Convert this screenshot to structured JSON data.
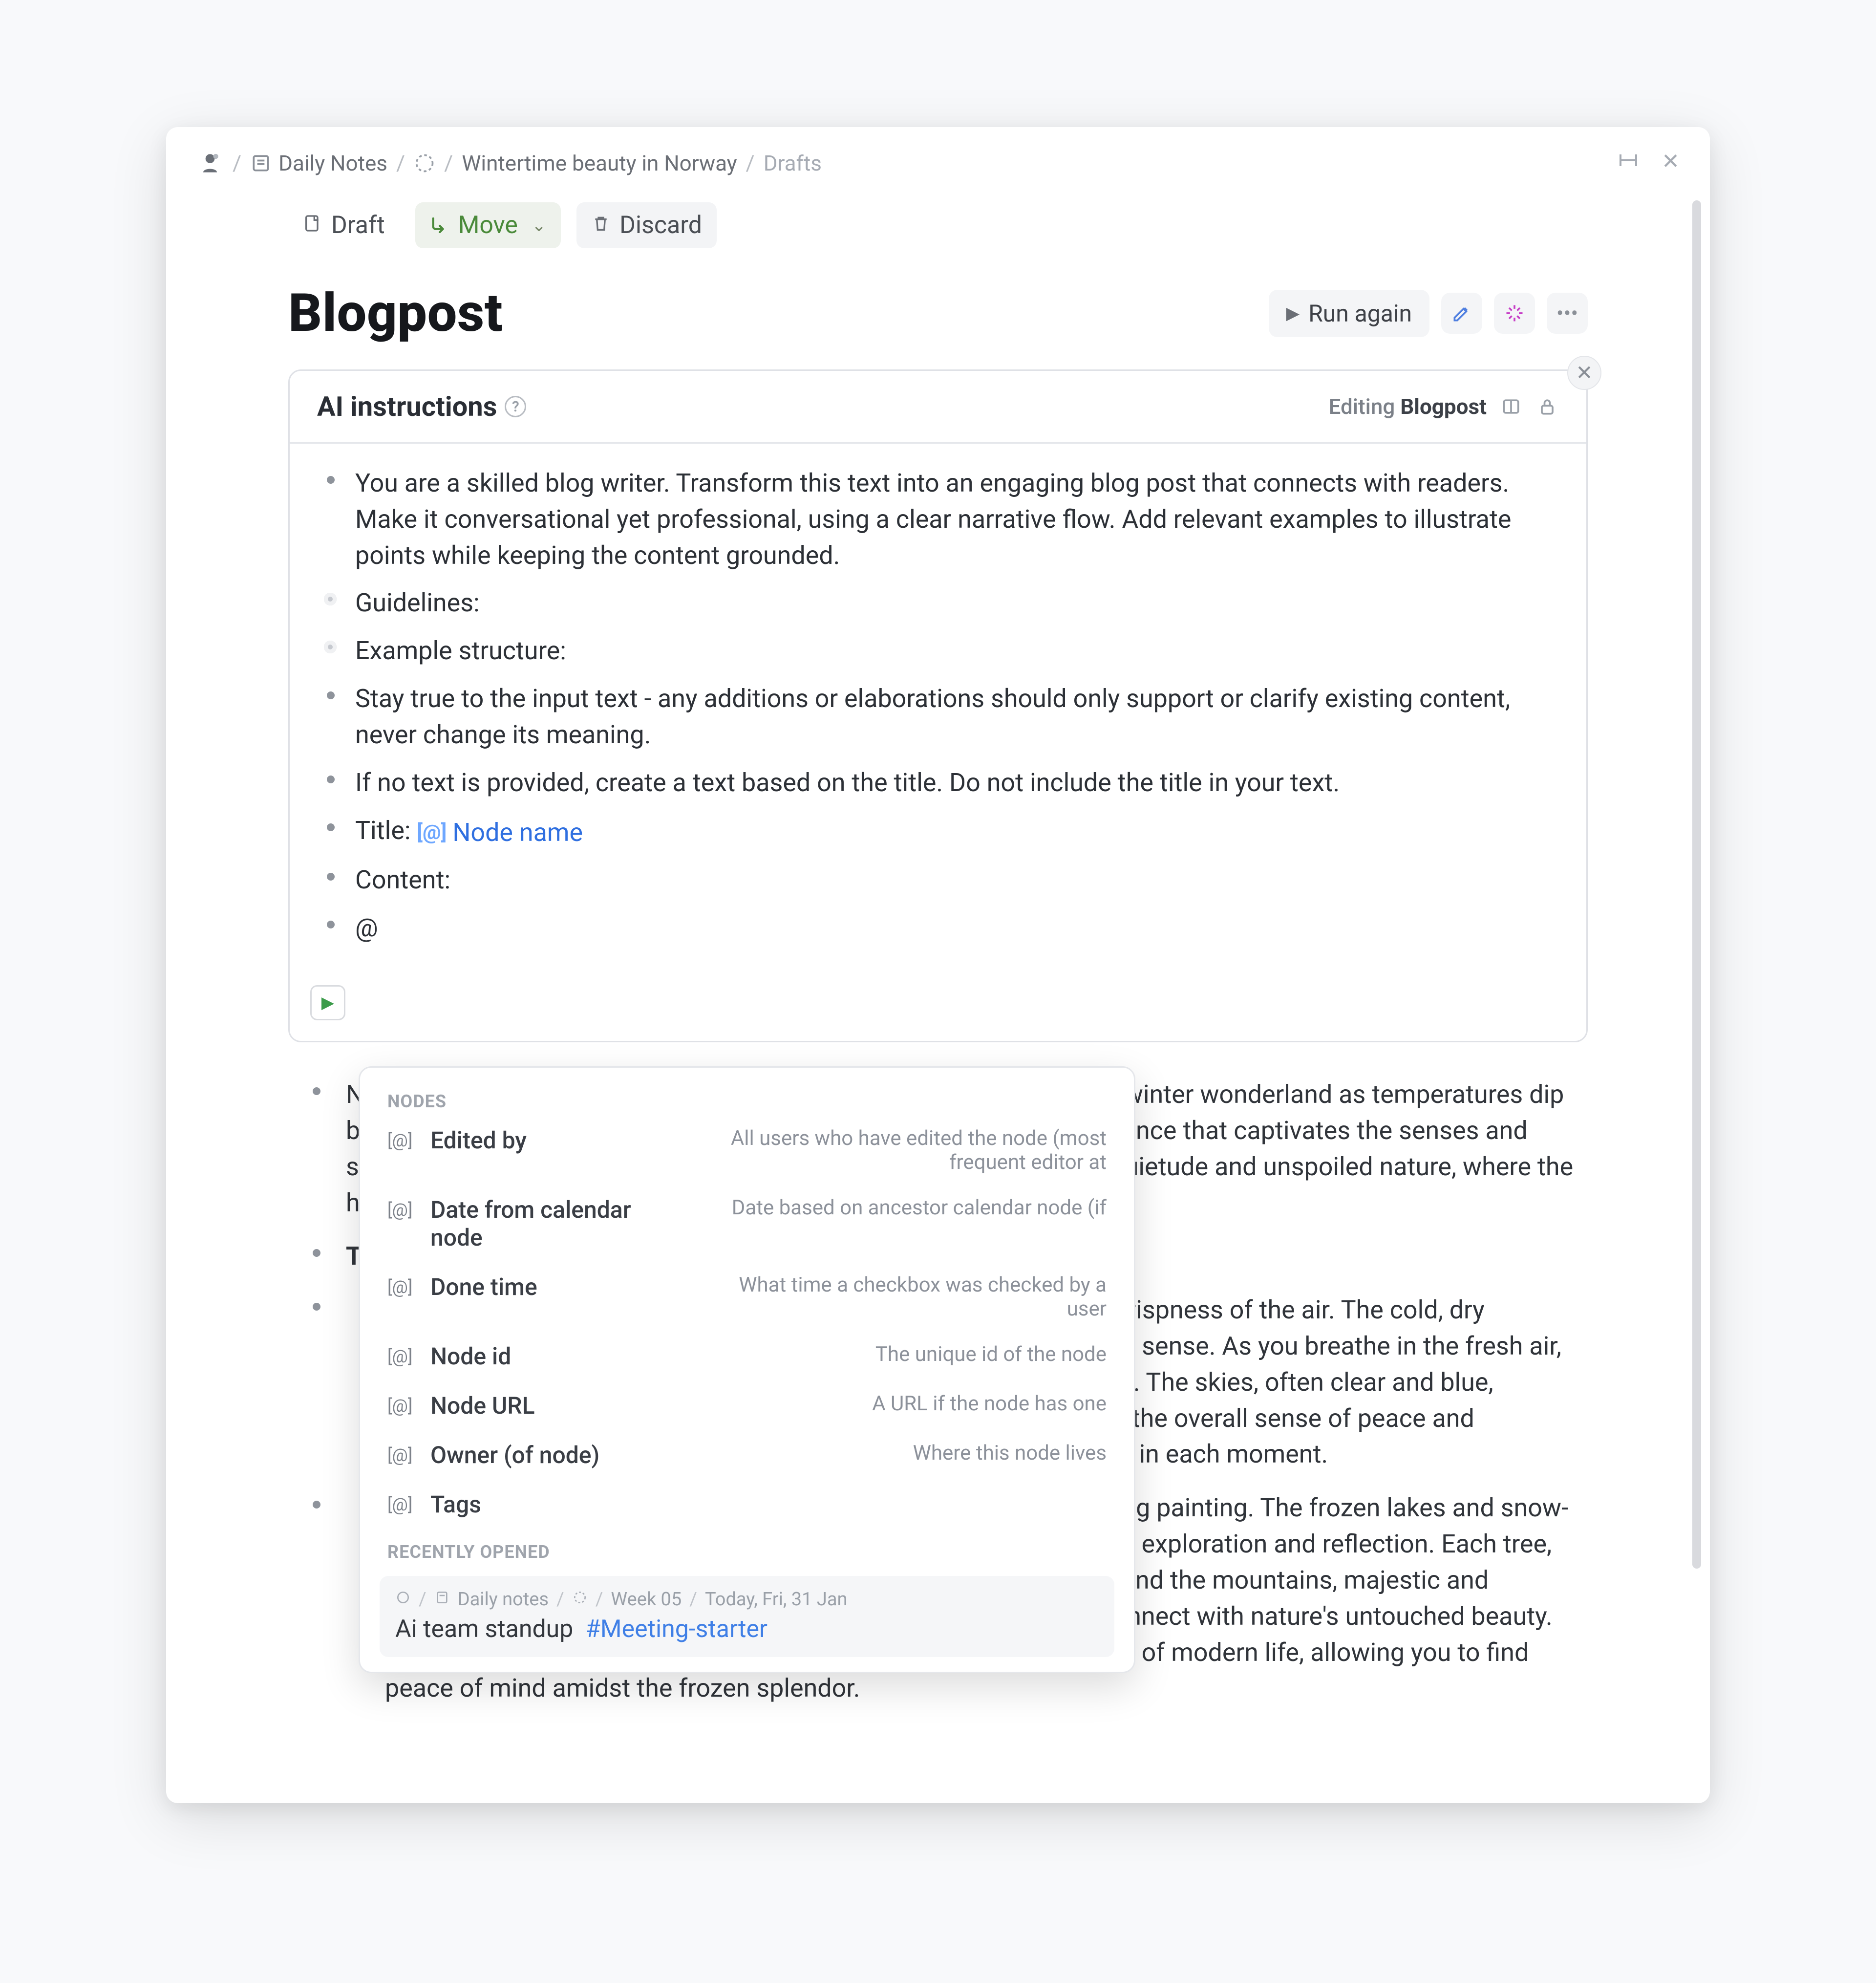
{
  "breadcrumbs": {
    "daily_notes": "Daily Notes",
    "page": "Wintertime beauty in Norway",
    "tail": "Drafts"
  },
  "toolbar": {
    "draft": "Draft",
    "move": "Move",
    "discard": "Discard"
  },
  "title": "Blogpost",
  "actions": {
    "run_again": "Run again"
  },
  "panel": {
    "heading": "AI instructions",
    "editing_prefix": "Editing",
    "editing_target": "Blogpost",
    "bullets": {
      "intro": "You are a skilled blog writer. Transform this text into an engaging blog post that connects with readers. Make it conversational yet professional, using a clear narrative flow. Add relevant examples to illustrate points while keeping the content grounded.",
      "guidelines": "Guidelines:",
      "example_structure": "Example structure:",
      "stay_true": "Stay true to the input text - any additions or elaborations should only support or clarify existing content, never change its meaning.",
      "no_text": "If no text is provided, create a text based on the title. Do not include the title in your text.",
      "title_prefix": "Title:",
      "title_chip": "Node name",
      "content_label": "Content:",
      "at": "@"
    }
  },
  "dropdown": {
    "section_nodes": "NODES",
    "items": [
      {
        "name": "Edited by",
        "desc": "All users who have edited the node (most frequent editor at"
      },
      {
        "name": "Date from calendar node",
        "desc": "Date based on ancestor calendar node (if"
      },
      {
        "name": "Done time",
        "desc": "What time a checkbox was checked by a user"
      },
      {
        "name": "Node id",
        "desc": "The unique id of the node"
      },
      {
        "name": "Node URL",
        "desc": "A URL if the node has one"
      },
      {
        "name": "Owner (of node)",
        "desc": "Where this node lives"
      },
      {
        "name": "Tags",
        "desc": ""
      }
    ],
    "section_recent": "RECENTLY OPENED",
    "recent": {
      "crumb_daily": "Daily notes",
      "crumb_week": "Week 05",
      "crumb_day": "Today, Fri, 31 Jan",
      "title": "Ai team standup",
      "tag": "#Meeting-starter"
    }
  },
  "article": {
    "p1": "Norway in winter is a magical destination, transforming into a serene winter wonderland as temperatures dip below freezing. This frozen beauty offers a unique and tranquil experience that captivates the senses and soothes the soul. Imagine a world where every corner is a pocket of quietude and unspoiled nature, where the hustle of daily life feels like a distant memory.",
    "h1": "The Crisp Air and Clear Skies",
    "p2_1": "One of the first things you'll notice upon arriving in Norway is the crispness of the air. The cold, dry atmosphere creates an almost ethereal quality that sharpens every sense. As you breathe in the fresh air, you feel invigorated, as if each breath cleanses you from the inside. The skies, often clear and blue, contrast beautifully with the snow-covered landscapes, enhancing the overall sense of peace and tranquility. Silence reigns supreme, allowing you to truly be present in each moment.",
    "p2_2": "The landscapes in Norway during winter are nothing short of a living painting. The frozen lakes and snow-draped forests create a picturesque scene of calmness that invites exploration and reflection. Each tree, heavy with snow, looks like it's been dusted with powdered sugar, and the mountains, majestic and imposing, add to the sense of awe. It's a place where you can reconnect with nature's untouched beauty. This serene environment offers a perfect escape from the stresses of modern life, allowing you to find peace of mind amidst the frozen splendor."
  }
}
